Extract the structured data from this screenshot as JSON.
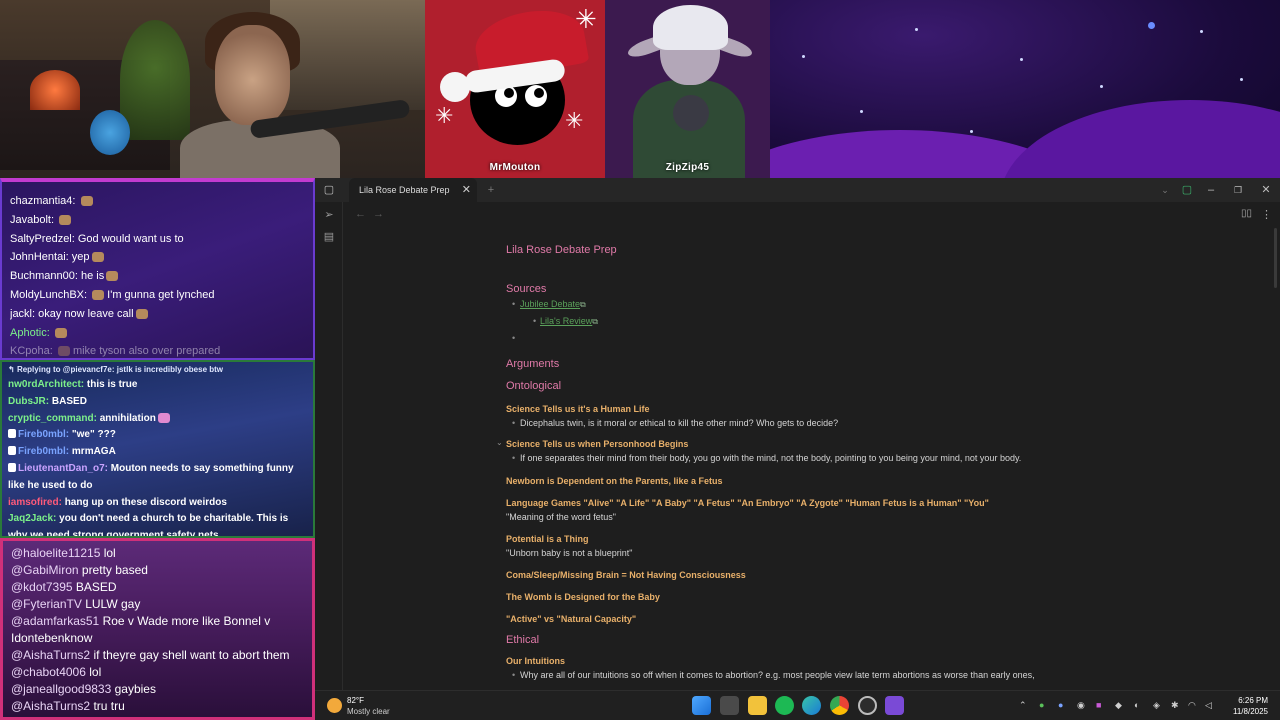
{
  "stream": {
    "friends": [
      {
        "name": "MrMouton"
      },
      {
        "name": "ZipZip45"
      }
    ]
  },
  "chat_top": [
    {
      "user": "chazmantia4:",
      "msg": "",
      "color": "#ffffff"
    },
    {
      "user": "Javabolt:",
      "msg": "",
      "color": "#ffffff"
    },
    {
      "user": "SaltyPredzel:",
      "msg": "God would want us to",
      "color": "#ffffff"
    },
    {
      "user": "JohnHentai:",
      "msg": "yep",
      "color": "#ffffff"
    },
    {
      "user": "Buchmann00:",
      "msg": "he is",
      "color": "#ffffff"
    },
    {
      "user": "MoldyLunchBX:",
      "msg": "I'm gunna get lynched",
      "color": "#ffffff"
    },
    {
      "user": "jackl:",
      "msg": "okay now leave call",
      "color": "#ffffff"
    },
    {
      "user": "Aphotic:",
      "msg": "",
      "color": "#7cf08a"
    },
    {
      "user": "KCpoha:",
      "msg": "mike tyson also over prepared",
      "color": "#a9a3d6"
    }
  ],
  "chat_mid": {
    "reply": "Replying to @pievancf7e: jstlk is incredibly obese btw",
    "lines": [
      {
        "user": "nw0rdArchitect:",
        "msg": "this is true",
        "color": "#7cf08a"
      },
      {
        "user": "DubsJR:",
        "msg": "BASED",
        "color": "#7cf08a"
      },
      {
        "user": "cryptic_command:",
        "msg": "annihilation",
        "color": "#7cf08a"
      },
      {
        "user": "Fireb0mbl:",
        "msg": "\"we\" ???",
        "color": "#7aa3ff"
      },
      {
        "user": "Fireb0mbl:",
        "msg": "mrmAGA",
        "color": "#7aa3ff"
      },
      {
        "user": "LieutenantDan_o7:",
        "msg": "Mouton needs to say something funny like he used to do",
        "color": "#c9a3ff"
      },
      {
        "user": "iamsofired:",
        "msg": "hang up on these discord weirdos",
        "color": "#ff5a7a"
      },
      {
        "user": "Jaq2Jack:",
        "msg": "you don't need a church to be charitable. This is why we need strong government safety nets",
        "color": "#7cf08a"
      }
    ]
  },
  "chat_bottom": [
    {
      "user": "@haloelite11215",
      "msg": "lol"
    },
    {
      "user": "@GabiMiron",
      "msg": "pretty based"
    },
    {
      "user": "@kdot7395",
      "msg": "BASED"
    },
    {
      "user": "@FyterianTV",
      "msg": "LULW gay"
    },
    {
      "user": "@adamfarkas51",
      "msg": "Roe v Wade more like Bonnel v Idontebenknow"
    },
    {
      "user": "@AishaTurns2",
      "msg": "if theyre gay shell want to abort them"
    },
    {
      "user": "@chabot4006",
      "msg": "lol"
    },
    {
      "user": "@janeallgood9833",
      "msg": "gaybies"
    },
    {
      "user": "@AishaTurns2",
      "msg": "tru tru"
    }
  ],
  "app": {
    "tab_title": "Lila Rose Debate Prep",
    "doc": {
      "title": "Lila Rose Debate Prep",
      "sources_heading": "Sources",
      "source_link_1": "Jubilee Debate",
      "source_link_2": "Lila's Review",
      "arguments_heading": "Arguments",
      "ontological_heading": "Ontological",
      "s1_title": "Science Tells us it's a Human Life",
      "s1_bullet": "Dicephalus twin, is it moral or ethical to kill the other mind? Who gets to decide?",
      "s2_title": "Science Tells us when Personhood Begins",
      "s2_bullet": "If one separates their mind from their body, you go with the mind, not the body, pointing to you being your mind, not your body.",
      "s3_title": "Newborn is Dependent on the Parents, like a Fetus",
      "s4_title": "Language Games \"Alive\" \"A Life\" \"A Baby\" \"A Fetus\" \"An Embryo\" \"A Zygote\" \"Human Fetus is a Human\" \"You\"",
      "s4_text": "\"Meaning of the word fetus\"",
      "s5_title": "Potential is a Thing",
      "s5_text": "\"Unborn baby is not a blueprint\"",
      "s6_title": "Coma/Sleep/Missing Brain = Not Having Consciousness",
      "s7_title": "The Womb is Designed for the Baby",
      "s8_title": "\"Active\" vs \"Natural Capacity\"",
      "ethical_heading": "Ethical",
      "s9_title": "Our Intuitions",
      "s9_bullet": "Why are all of our intuitions so off when it comes to abortion? e.g. most people view late term abortions as worse than early ones,"
    }
  },
  "taskbar": {
    "temp": "82°F",
    "weather": "Mostly clear",
    "time": "6:26 PM",
    "date": "11/8/2025"
  },
  "colors": {
    "heading_pink": "#e07aa8",
    "heading_orange": "#e8b06a",
    "link_green": "#5aa05a"
  }
}
